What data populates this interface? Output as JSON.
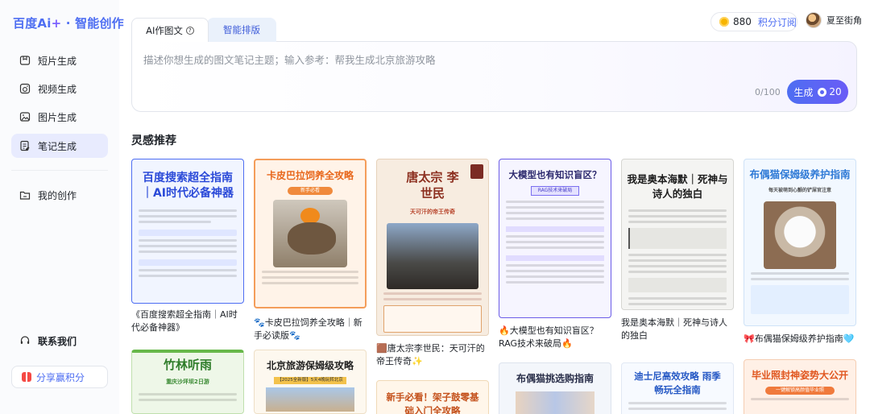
{
  "brand": {
    "name": "百度",
    "ai": "Ai",
    "plus": "+",
    "product": " · 智能创作"
  },
  "sidebar": {
    "items": [
      {
        "label": "短片生成",
        "icon": "film-icon"
      },
      {
        "label": "视频生成",
        "icon": "video-icon"
      },
      {
        "label": "图片生成",
        "icon": "image-icon"
      },
      {
        "label": "笔记生成",
        "icon": "note-icon",
        "active": true
      }
    ],
    "my_works": "我的创作",
    "contact": "联系我们",
    "share": "分享赢积分"
  },
  "header": {
    "points": "880",
    "subscribe": "积分订阅",
    "username": "夏至街角"
  },
  "tabs": [
    {
      "label": "AI作图文",
      "active": true
    },
    {
      "label": "智能排版",
      "active": false
    }
  ],
  "editor": {
    "placeholder": "描述你想生成的图文笔记主题；输入参考：帮我生成北京旅游攻略",
    "counter": "0/100",
    "generate_label": "生成",
    "generate_cost": "20"
  },
  "inspiration": {
    "title": "灵感推荐",
    "cards_row1": [
      {
        "thumb_title": "百度搜索超全指南｜AI时代必备神器",
        "caption": "《百度搜索超全指南｜AI时代必备神器》"
      },
      {
        "thumb_title": "卡皮巴拉饲养全攻略",
        "thumb_badge": "新手必看",
        "caption": "🐾卡皮巴拉饲养全攻略｜新手必读版🐾"
      },
      {
        "thumb_title": "唐太宗 李世民",
        "thumb_sub": "天可汗的帝王传奇",
        "caption": "🟫唐太宗李世民：天可汗的帝王传奇✨"
      },
      {
        "thumb_title": "大模型也有知识盲区？",
        "thumb_badge": "RAG技术来破局",
        "caption": "🔥大模型也有知识盲区？RAG技术来破局🔥"
      },
      {
        "thumb_title": "我是奥本海默｜死神与诗人的独白",
        "caption": "我是奥本海默｜死神与诗人的独白"
      },
      {
        "thumb_title": "布偶猫保姆级养护指南",
        "thumb_sub": "每天被萌到心颤的铲屎官注意",
        "caption": "🎀布偶猫保姆级养护指南🩵"
      }
    ],
    "cards_row2": [
      {
        "thumb_title": "竹林听雨",
        "thumb_sub": "重庆沙坪坝2日游"
      },
      {
        "thumb_title": "北京旅游保姆级攻略",
        "thumb_badge": "【2025全新版】5天4晚玩转北京"
      },
      {
        "thumb_title": "新手必看！架子鼓零基础入门全攻略"
      },
      {
        "thumb_title": "布偶猫挑选购指南"
      },
      {
        "thumb_title": "迪士尼高效攻略 雨季畅玩全指南"
      },
      {
        "thumb_title": "毕业照封神姿势大公开",
        "thumb_badge": "一键解锁高颜值毕业照"
      }
    ]
  }
}
